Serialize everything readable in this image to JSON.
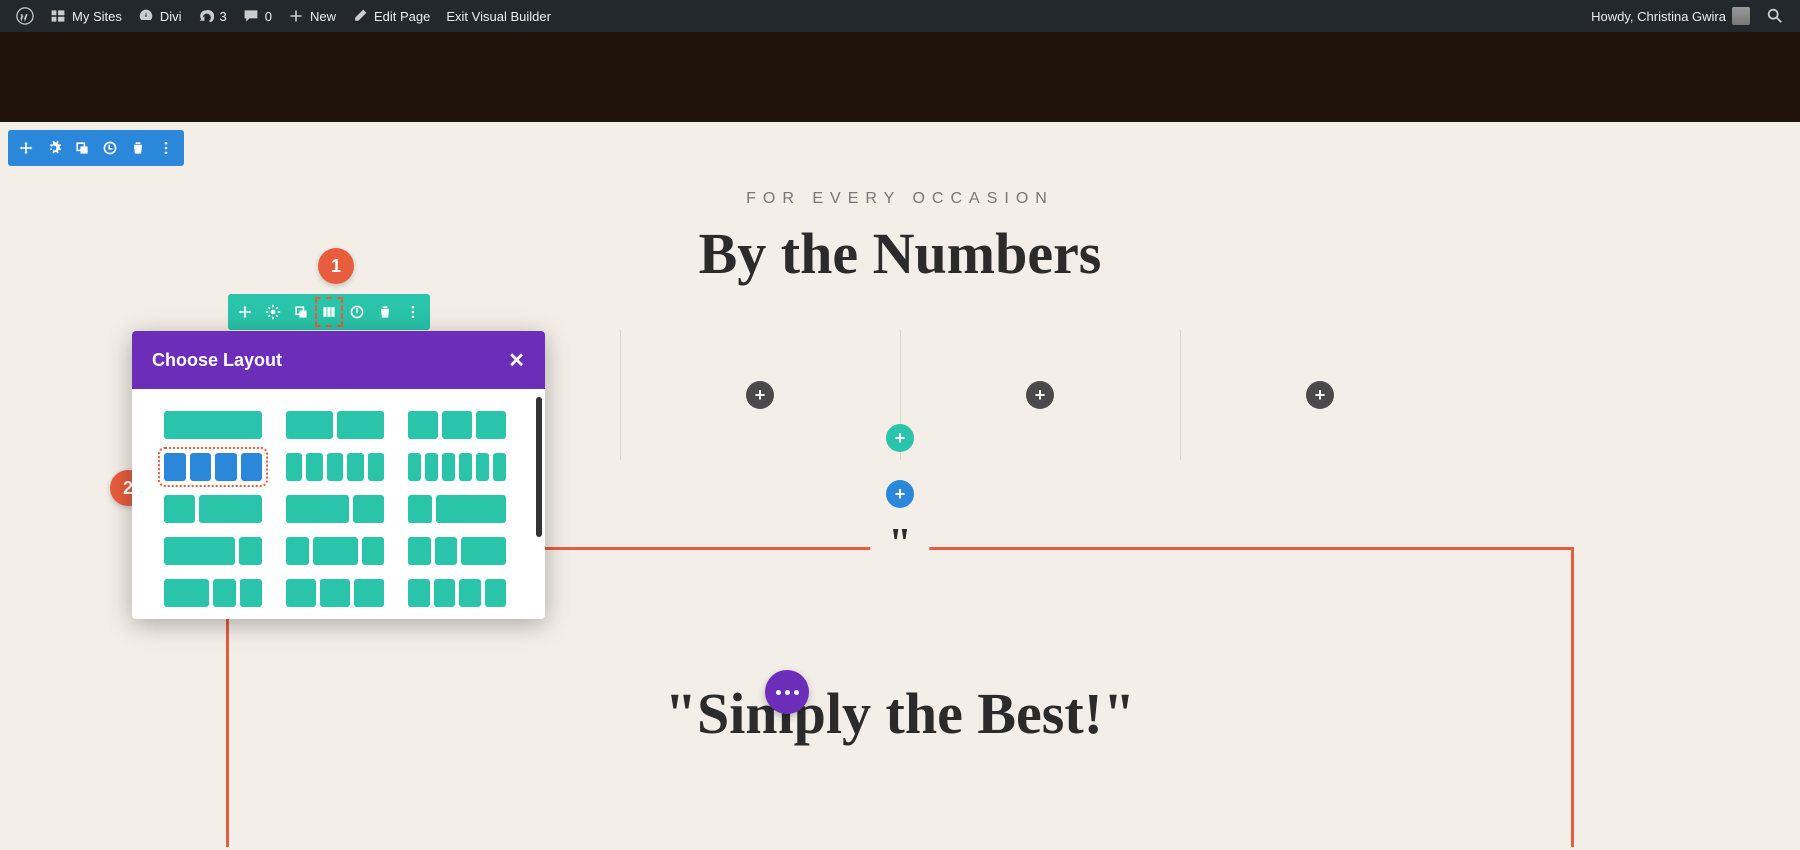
{
  "adminBar": {
    "mySites": "My Sites",
    "siteName": "Divi",
    "updates": "3",
    "comments": "0",
    "new": "New",
    "editPage": "Edit Page",
    "exitVB": "Exit Visual Builder",
    "howdy": "Howdy, Christina Gwira"
  },
  "page": {
    "overline": "FOR EVERY OCCASION",
    "heading": "By the Numbers",
    "quote": "\"Simply the Best!\""
  },
  "popup": {
    "title": "Choose Layout"
  },
  "anno": {
    "one": "1",
    "two": "2"
  }
}
